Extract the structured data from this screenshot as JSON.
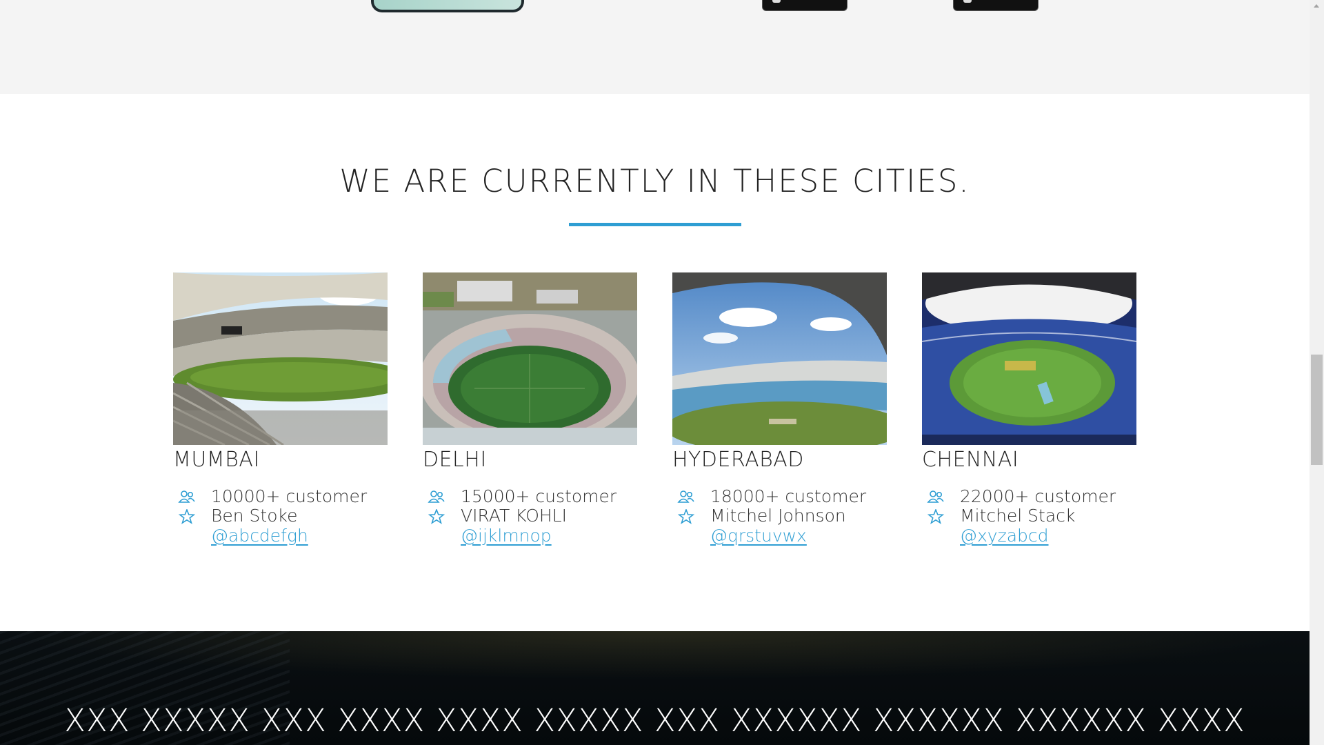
{
  "colors": {
    "accent": "#2e9ed3",
    "banner_bg": "#05090b",
    "top_band_bg": "#f4f4f4"
  },
  "cities_section": {
    "title": "WE ARE CURRENTLY IN THESE CITIES.",
    "cities": [
      {
        "name": "MUMBAI",
        "customers": "10000+ customer",
        "player": "Ben Stoke",
        "handle": "@abcdefgh",
        "customer_icon": "users-icon",
        "player_icon": "star-icon"
      },
      {
        "name": "DELHI",
        "customers": "15000+ customer",
        "player": "VIRAT KOHLI",
        "handle": "@ijklmnop",
        "customer_icon": "users-icon",
        "player_icon": "star-icon"
      },
      {
        "name": "HYDERABAD",
        "customers": "18000+ customer",
        "player": "Mitchel Johnson",
        "handle": "@qrstuvwx",
        "customer_icon": "users-icon",
        "player_icon": "star-icon"
      },
      {
        "name": "CHENNAI",
        "customers": "22000+ customer",
        "player": "Mitchel Stack",
        "handle": "@xyzabcd",
        "customer_icon": "users-icon",
        "player_icon": "star-icon"
      }
    ]
  },
  "banner": {
    "text": "XXX XXXXX XXX XXXX XXXX XXXXX XXX XXXXXX XXXXXX XXXXXX XXXX"
  }
}
